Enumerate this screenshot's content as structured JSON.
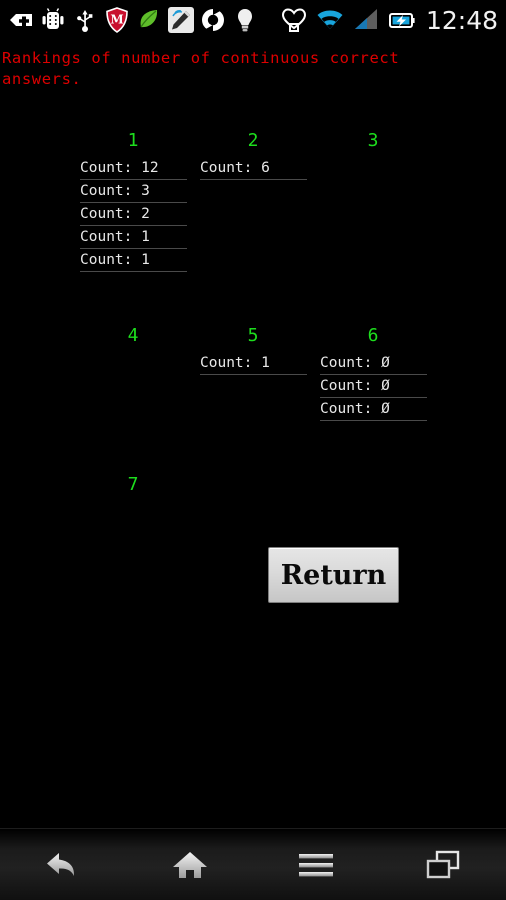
{
  "status_bar": {
    "icons": [
      {
        "name": "add-icon",
        "label": "+"
      },
      {
        "name": "android-robot-icon",
        "label": "android"
      },
      {
        "name": "usb-icon",
        "label": "usb"
      },
      {
        "name": "mcafee-shield-icon",
        "label": "M"
      },
      {
        "name": "leaf-icon",
        "label": "leaf"
      },
      {
        "name": "stylus-pen-icon",
        "label": "pen"
      },
      {
        "name": "sync-icon",
        "label": "sync"
      },
      {
        "name": "lightbulb-icon",
        "label": "bulb"
      },
      {
        "name": "heart-icon",
        "label": "heart"
      },
      {
        "name": "wifi-icon",
        "label": "wifi"
      },
      {
        "name": "signal-bars-icon",
        "label": "signal"
      },
      {
        "name": "battery-charging-icon",
        "label": "battery"
      }
    ],
    "clock": "12:48"
  },
  "title": "Rankings of number of continuous correct answers.",
  "colors": {
    "title_red": "#dd0000",
    "rank_green": "#1ddd1d",
    "row_text": "#e8e8e8",
    "separator": "#4a4a4a",
    "background": "#000000"
  },
  "ranks": [
    {
      "header": "1",
      "rows": [
        "Count: 12",
        "Count: 3",
        "Count: 2",
        "Count: 1",
        "Count: 1"
      ]
    },
    {
      "header": "2",
      "rows": [
        "Count: 6"
      ]
    },
    {
      "header": "3",
      "rows": []
    },
    {
      "header": "4",
      "rows": []
    },
    {
      "header": "5",
      "rows": [
        "Count: 1"
      ]
    },
    {
      "header": "6",
      "rows": [
        "Count: Ø",
        "Count: Ø",
        "Count: Ø"
      ]
    },
    {
      "header": "7",
      "rows": []
    },
    {
      "header": "",
      "rows": []
    },
    {
      "header": "",
      "rows": []
    }
  ],
  "return_button": {
    "label": "Return"
  },
  "nav_bar": {
    "buttons": [
      {
        "name": "nav-back-button",
        "label": "Back"
      },
      {
        "name": "nav-home-button",
        "label": "Home"
      },
      {
        "name": "nav-menu-button",
        "label": "Menu"
      },
      {
        "name": "nav-recents-button",
        "label": "Recent apps"
      }
    ]
  }
}
